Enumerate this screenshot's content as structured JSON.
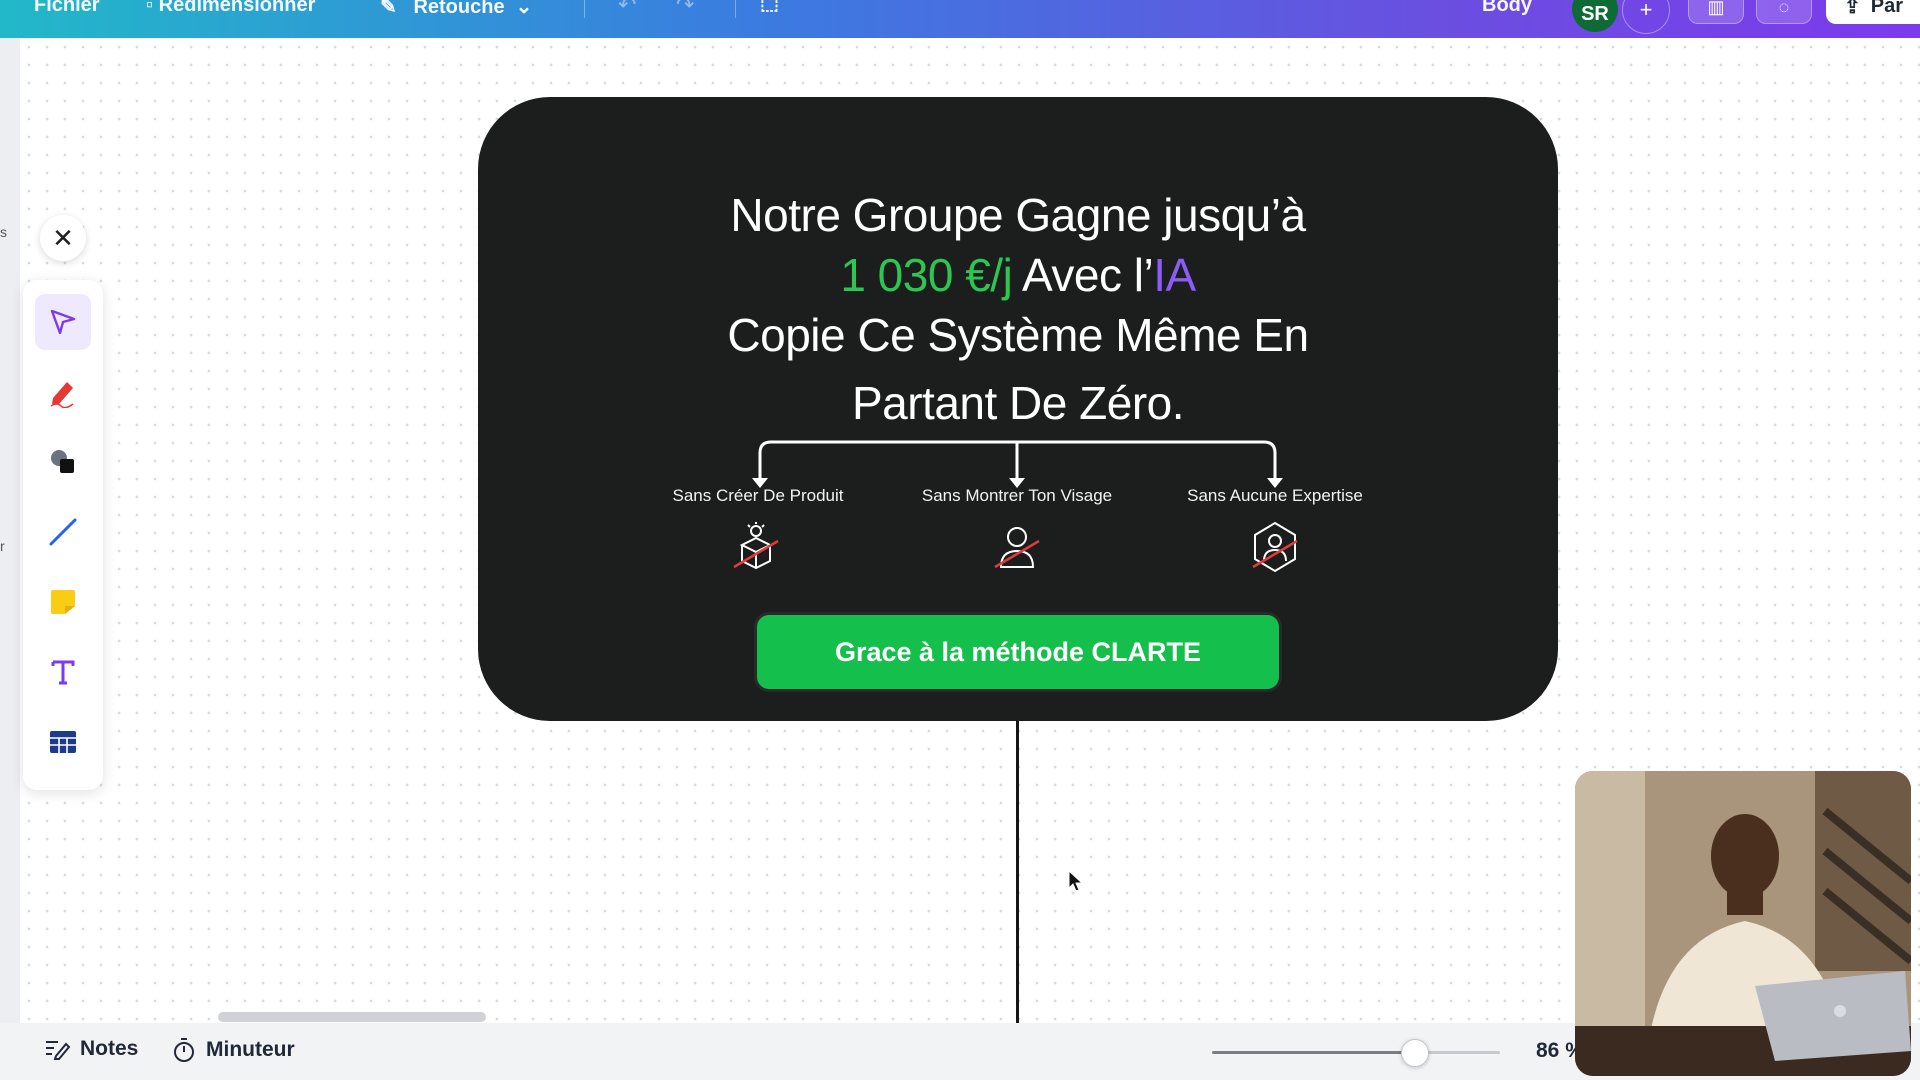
{
  "topbar": {
    "file_label": "Fichier",
    "resize_label": "Redimensionner",
    "retouch_label": "Retouche",
    "page_label": "Body",
    "avatar_initials": "SR",
    "share_label": "Par"
  },
  "card": {
    "headline_line1": "Notre Groupe Gagne jusqu’à",
    "headline_amount": "1 030 €/j",
    "headline_mid": " Avec l’",
    "headline_ai": "IA",
    "headline_line3": "Copie Ce Système Même En",
    "headline_line4": "Partant De Zéro.",
    "features": [
      {
        "label": "Sans Créer De Produit",
        "icon": "no-product-icon"
      },
      {
        "label": "Sans Montrer Ton Visage",
        "icon": "no-face-icon"
      },
      {
        "label": "Sans Aucune Expertise",
        "icon": "no-expertise-icon"
      }
    ],
    "cta_label": "Grace à la méthode CLARTE",
    "colors": {
      "background": "#1c1d1d",
      "green": "#2dc653",
      "purple": "#8b5cf6",
      "cta": "#14c04b"
    }
  },
  "toolbar": {
    "close_icon": "close-icon",
    "tools": [
      "select-icon",
      "draw-icon",
      "shapes-icon",
      "line-icon",
      "sticky-note-icon",
      "text-icon",
      "table-icon"
    ]
  },
  "bottombar": {
    "notes_label": "Notes",
    "timer_label": "Minuteur",
    "zoom_label": "86 %",
    "zoom_level": 0.7
  }
}
